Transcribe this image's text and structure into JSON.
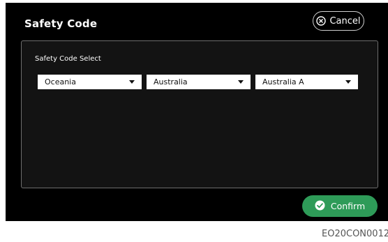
{
  "dialog": {
    "title": "Safety Code",
    "cancel_label": "Cancel",
    "confirm_label": "Confirm"
  },
  "panel": {
    "label": "Safety Code  Select",
    "selects": [
      {
        "value": "Oceania"
      },
      {
        "value": "Australia"
      },
      {
        "value": "Australia A"
      }
    ]
  },
  "figure_code": "EO20CON0012",
  "colors": {
    "dialog_bg": "#000000",
    "panel_bg": "#131313",
    "confirm_bg": "#2e9b58",
    "text": "#ffffff"
  },
  "icons": {
    "cancel": "close-circle-icon",
    "confirm": "check-circle-icon",
    "dropdown": "caret-down-icon"
  }
}
